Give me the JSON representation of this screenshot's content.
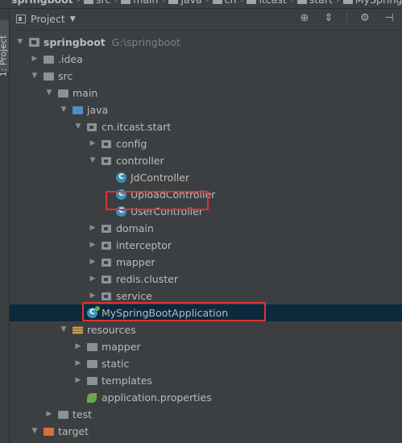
{
  "breadcrumbs": [
    {
      "label": "springboot",
      "bold": true
    },
    {
      "label": "src"
    },
    {
      "label": "main"
    },
    {
      "label": "java"
    },
    {
      "label": "cn"
    },
    {
      "label": "itcast"
    },
    {
      "label": "start"
    },
    {
      "label": "MySpring"
    }
  ],
  "side_strip": {
    "label": "1: Project"
  },
  "panel": {
    "view_selector": "Project",
    "toolbar_icons": [
      "target-icon",
      "collapse-icon",
      "gear-icon",
      "hide-icon"
    ]
  },
  "tree": [
    {
      "label": "springboot",
      "path": "G:\\springboot",
      "icon": "module-icon",
      "depth": 0,
      "expanded": true,
      "bold": true
    },
    {
      "label": ".idea",
      "icon": "folder-icon",
      "depth": 1,
      "expanded": false
    },
    {
      "label": "src",
      "icon": "folder-icon",
      "depth": 1,
      "expanded": true
    },
    {
      "label": "main",
      "icon": "folder-icon",
      "depth": 2,
      "expanded": true
    },
    {
      "label": "java",
      "icon": "source-folder-icon",
      "depth": 3,
      "expanded": true
    },
    {
      "label": "cn.itcast.start",
      "icon": "package-icon",
      "depth": 4,
      "expanded": true
    },
    {
      "label": "config",
      "icon": "package-icon",
      "depth": 5,
      "expanded": false
    },
    {
      "label": "controller",
      "icon": "package-icon",
      "depth": 5,
      "expanded": true
    },
    {
      "label": "JdController",
      "icon": "class-icon",
      "depth": 6
    },
    {
      "label": "UploadController",
      "icon": "class-icon",
      "depth": 6
    },
    {
      "label": "UserController",
      "icon": "class-icon",
      "depth": 6
    },
    {
      "label": "domain",
      "icon": "package-icon",
      "depth": 5,
      "expanded": false
    },
    {
      "label": "interceptor",
      "icon": "package-icon",
      "depth": 5,
      "expanded": false
    },
    {
      "label": "mapper",
      "icon": "package-icon",
      "depth": 5,
      "expanded": false
    },
    {
      "label": "redis.cluster",
      "icon": "package-icon",
      "depth": 5,
      "expanded": false
    },
    {
      "label": "service",
      "icon": "package-icon",
      "depth": 5,
      "expanded": false
    },
    {
      "label": "MySpringBootApplication",
      "icon": "spring-app-icon",
      "depth": 4,
      "selected": true
    },
    {
      "label": "resources",
      "icon": "resources-folder-icon",
      "depth": 3,
      "expanded": true
    },
    {
      "label": "mapper",
      "icon": "folder-icon",
      "depth": 4,
      "expanded": false
    },
    {
      "label": "static",
      "icon": "folder-icon",
      "depth": 4,
      "expanded": false
    },
    {
      "label": "templates",
      "icon": "folder-icon",
      "depth": 4,
      "expanded": false
    },
    {
      "label": "application.properties",
      "icon": "spring-leaf-icon",
      "depth": 4
    },
    {
      "label": "test",
      "icon": "folder-icon",
      "depth": 2,
      "expanded": false
    },
    {
      "label": "target",
      "icon": "excluded-folder-icon",
      "depth": 1,
      "expanded": true
    }
  ],
  "colors": {
    "background": "#3c3f41",
    "selection": "#0d293e",
    "highlight_box": "#e03131",
    "class_icon": "#3a8fb7",
    "spring_green": "#6aa84f"
  }
}
